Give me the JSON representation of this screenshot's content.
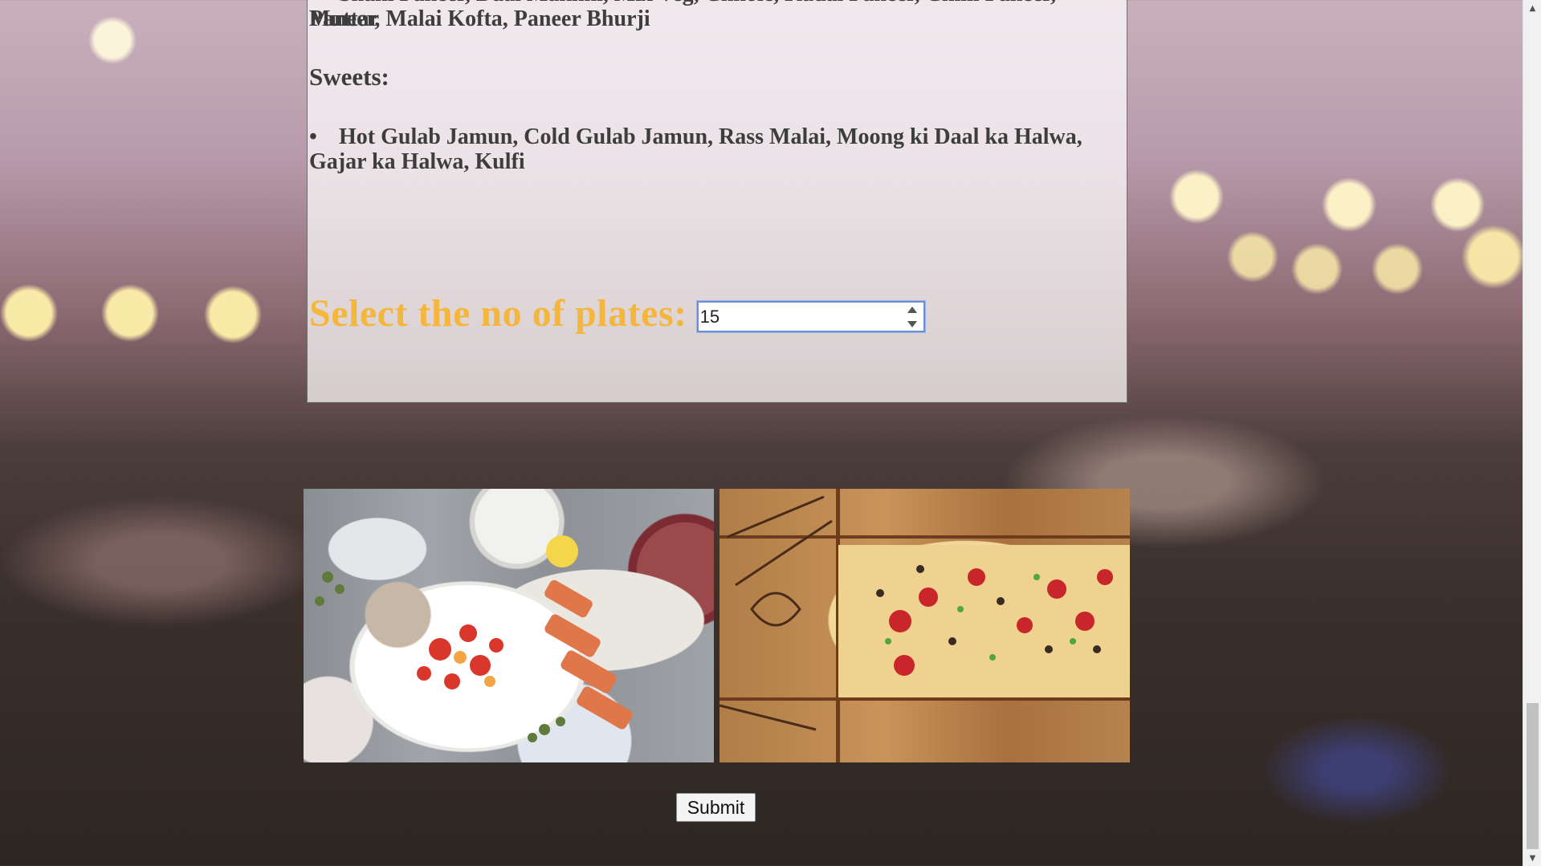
{
  "menu": {
    "main_course_items_line1": "Shahi Paneer, Daal Makhni, Mix Veg, Chhole, Kadai Paneer, Chilli Paneer, Muttar",
    "main_course_items_line2": "Paneer, Malai Kofta, Paneer Bhurji",
    "sweets_heading": "Sweets:",
    "sweets_items": "Hot Gulab Jamun, Cold Gulab Jamun, Rass Malai, Moong ki Daal ka Halwa, Gajar ka Halwa, Kulfi",
    "bullet": "•"
  },
  "plates": {
    "label": "Select the no of plates:",
    "value": "15"
  },
  "images": {
    "left_icon": "food-spread-image",
    "right_icon": "mac-and-cheese-image"
  },
  "form": {
    "submit_label": "Submit"
  },
  "scrollbar": {
    "up_arrow": "▲",
    "down_arrow": "▼"
  },
  "colors": {
    "plates_label": "#f4b63c",
    "menu_text": "#3d3d3d",
    "input_focus": "#6b8fd6"
  }
}
